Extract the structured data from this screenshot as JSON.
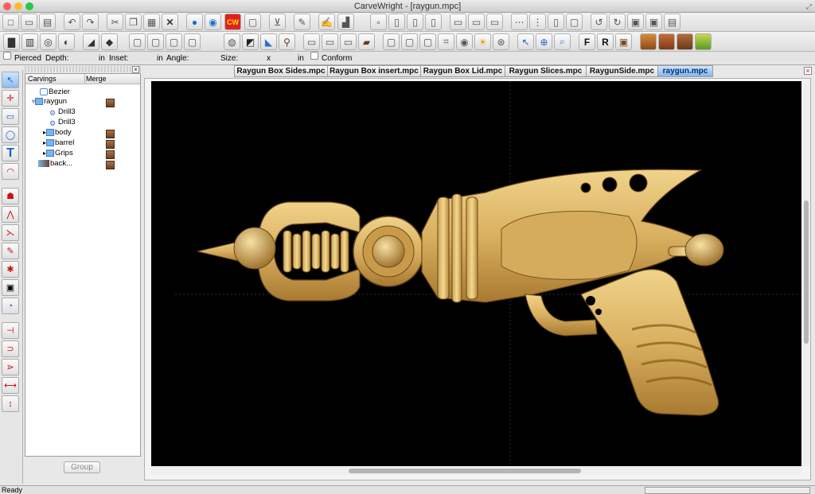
{
  "window": {
    "title": "CarveWright - [raygun.mpc]"
  },
  "options_bar": {
    "pierced_label": "Pierced",
    "depth_label": "Depth:",
    "depth_unit": "in",
    "inset_label": "Inset:",
    "inset_unit": "in",
    "angle_label": "Angle:",
    "size_label": "Size:",
    "size_sep": "x",
    "size_unit": "in",
    "conform_label": "Conform"
  },
  "tabs": [
    {
      "label": "Raygun Box Sides.mpc"
    },
    {
      "label": "Raygun Box insert.mpc"
    },
    {
      "label": "Raygun Box Lid.mpc"
    },
    {
      "label": "Raygun Slices.mpc"
    },
    {
      "label": "RaygunSide.mpc"
    },
    {
      "label": "raygun.mpc",
      "active": true
    }
  ],
  "tree": {
    "col_carvings": "Carvings",
    "col_merge": "Merge",
    "nodes": [
      {
        "label": "Bezier"
      },
      {
        "label": "raygun"
      },
      {
        "label": "Drill3"
      },
      {
        "label": "Drill3"
      },
      {
        "label": "body"
      },
      {
        "label": "barrel"
      },
      {
        "label": "Grips"
      },
      {
        "label": "back..."
      }
    ],
    "group_button": "Group"
  },
  "toolbar1_icons": [
    "new-icon",
    "open-icon",
    "save-icon",
    "undo-icon",
    "redo-icon",
    "cut-icon",
    "copy-icon",
    "paste-icon",
    "delete-icon",
    "carve-icon",
    "carve-preview-icon",
    "cw-logo-icon",
    "board-icon",
    "center-icon",
    "pencil-icon",
    "stamp-icon",
    "lock-icon",
    "pattern-icon",
    "align-icon"
  ],
  "toolbar2_icons": [
    "board-color-icon",
    "wood-grain-icon",
    "texture-icon",
    "shade-icon",
    "render-icon",
    "fill-icon",
    "mirror-icon",
    "rotate-icon",
    "flip-icon",
    "select-icon",
    "zoom-icon",
    "search-icon",
    "font-F-icon",
    "font-R-icon",
    "wood-icon",
    "view-icon",
    "grid-icon",
    "image-icon"
  ],
  "colors": {
    "canvas_bg": "#000000",
    "wood_light": "#e9c97a",
    "wood_dark": "#a87a30",
    "tab_active": "#7fb6ef"
  },
  "status": {
    "text": "Ready"
  }
}
